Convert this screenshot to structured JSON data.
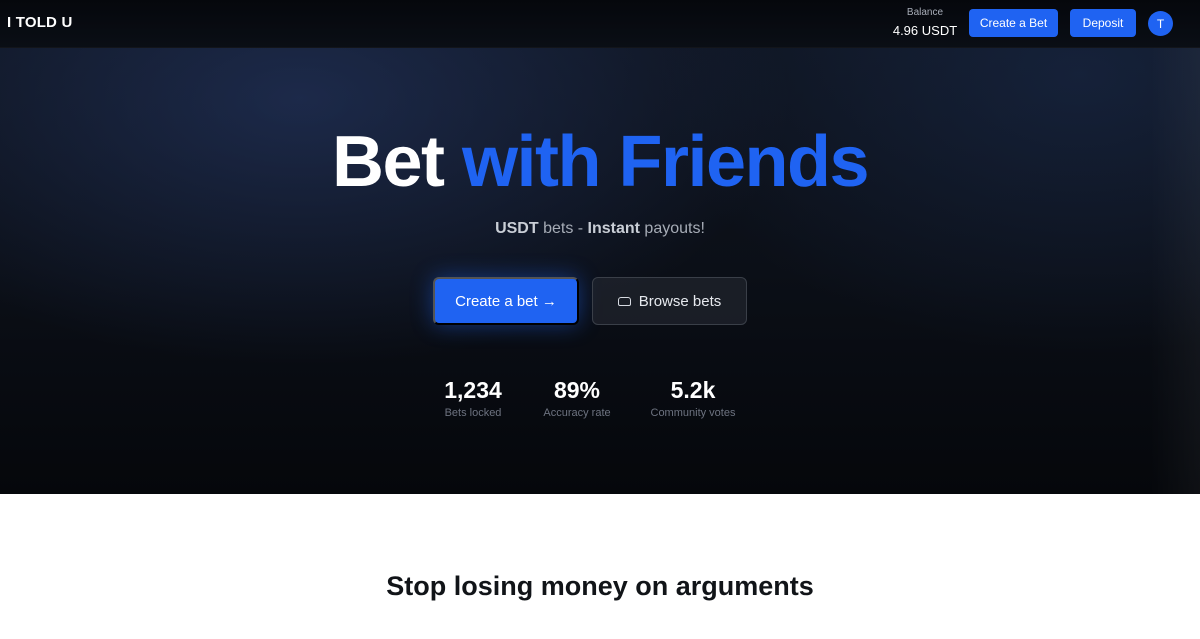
{
  "header": {
    "logo": "I TOLD U",
    "balance_label": "Balance",
    "balance_value": "4.96 USDT",
    "create_label": "Create a Bet",
    "deposit_label": "Deposit",
    "avatar_initial": "T"
  },
  "hero": {
    "headline_white": "Bet",
    "headline_blue": "with Friends",
    "subtitle": {
      "part1": "USDT",
      "part2": " bets - ",
      "part3": "Instant",
      "part4": " payouts!"
    },
    "cta_create_label": "Create a bet →",
    "cta_browse_label": "Browse bets",
    "stats": [
      {
        "value": "1,234",
        "label": "Bets locked"
      },
      {
        "value": "89%",
        "label": "Accuracy rate"
      },
      {
        "value": "5.2k",
        "label": "Community votes"
      }
    ]
  },
  "section": {
    "title": "Stop losing money on arguments"
  },
  "colors": {
    "accent": "#1f63f2",
    "hero_bg": "#0b0f17"
  },
  "icons": {
    "browse": "wallet-icon"
  }
}
